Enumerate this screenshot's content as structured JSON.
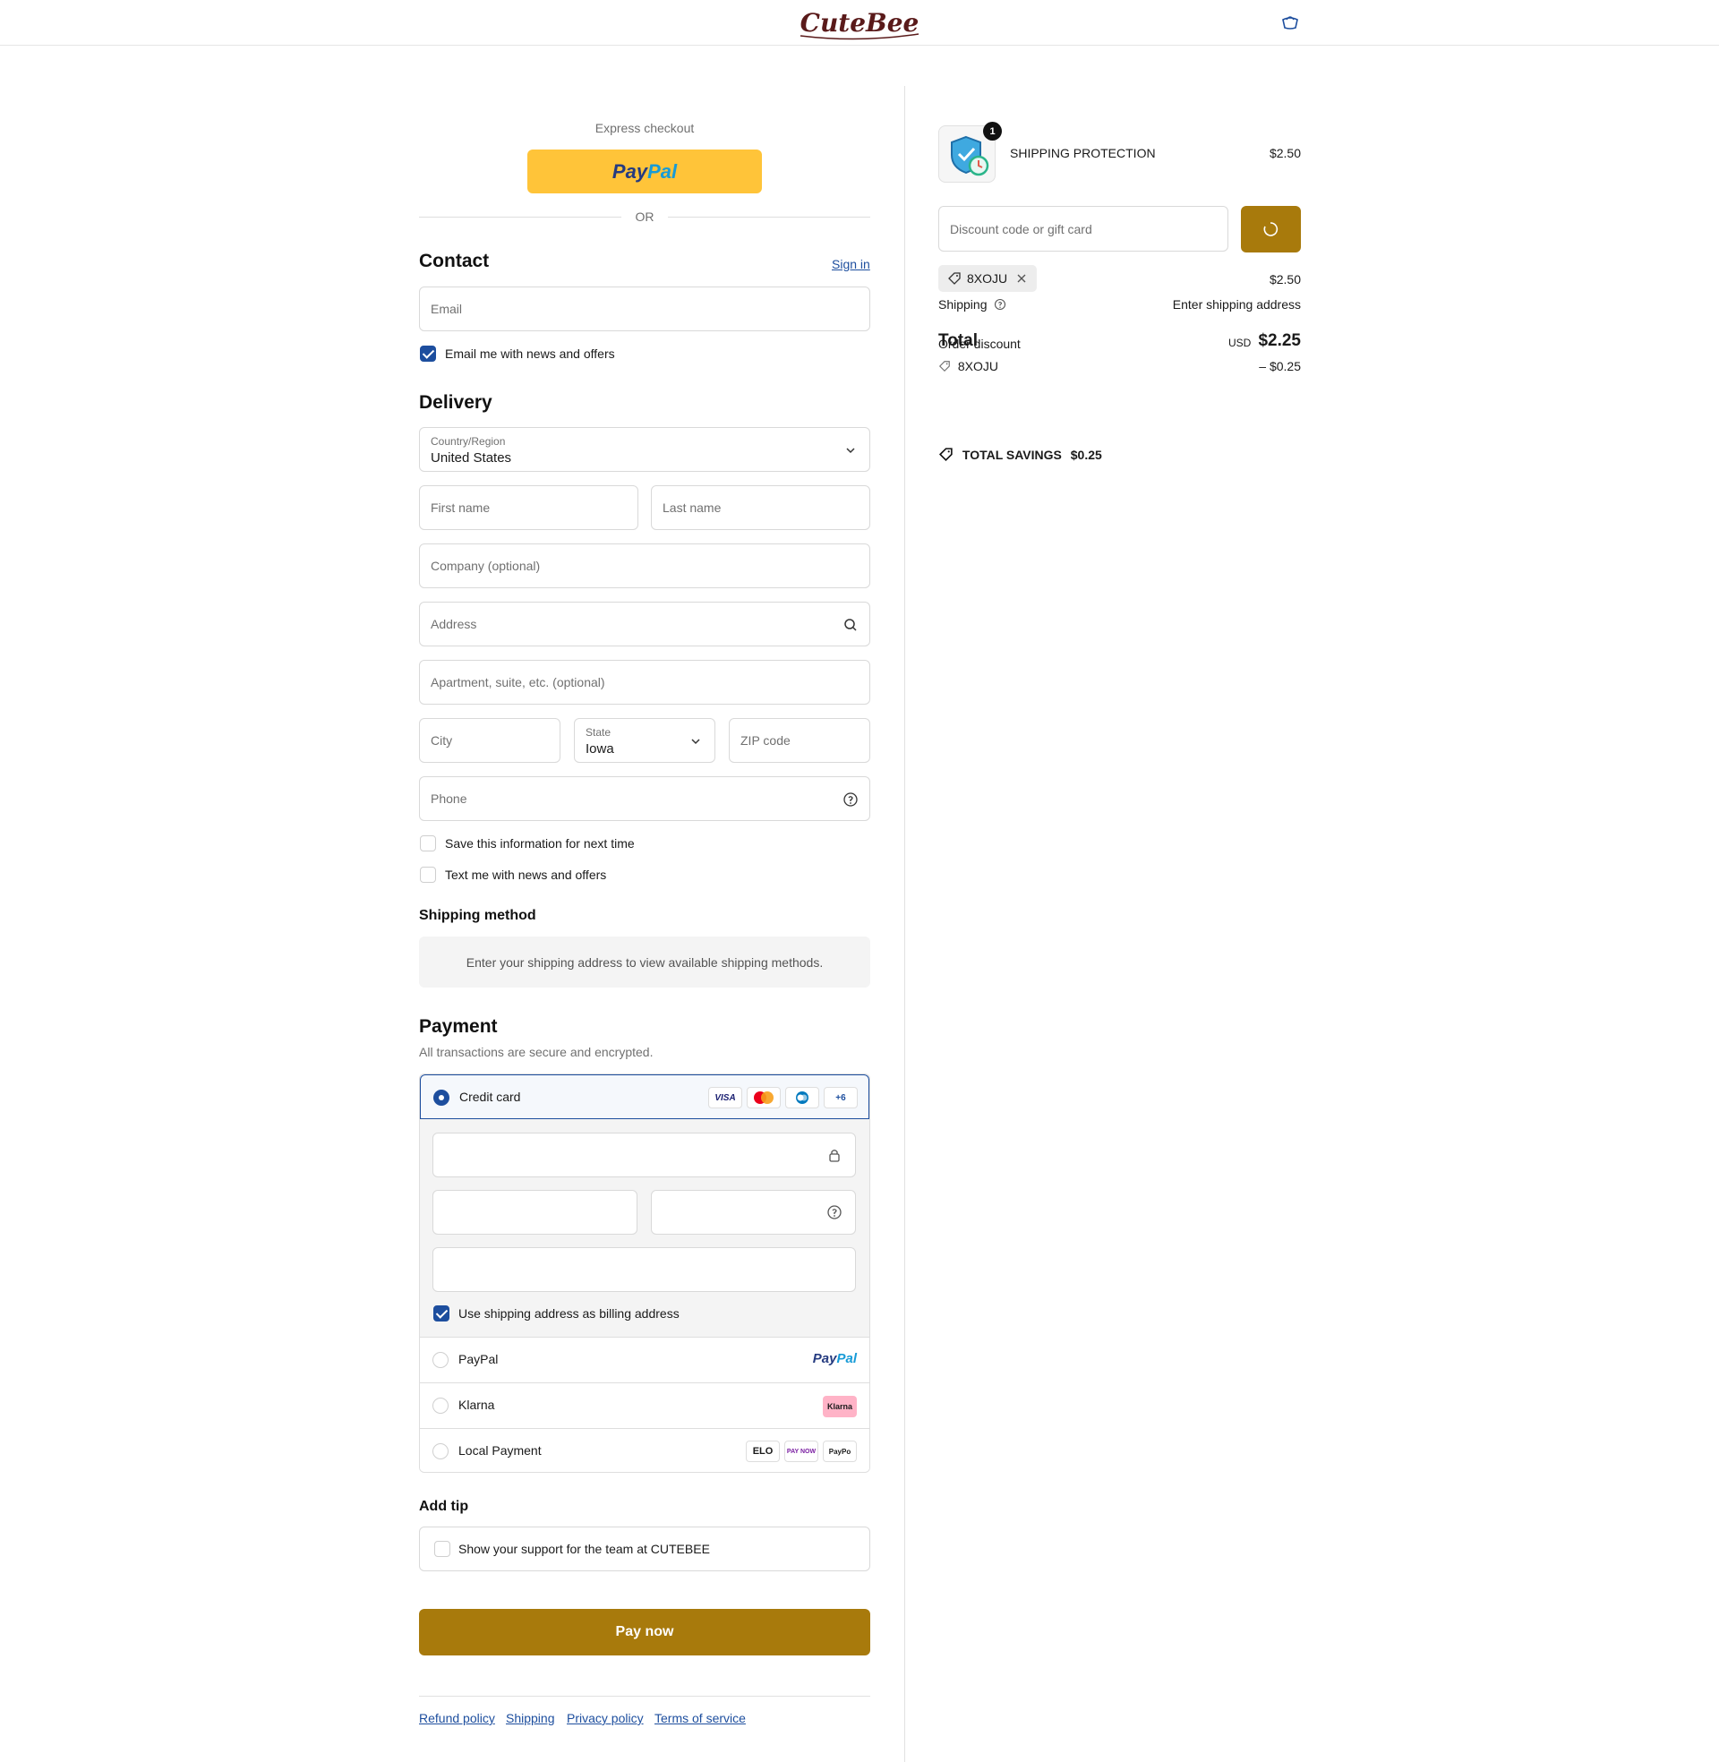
{
  "header": {
    "logo_text": "CuteBee",
    "cart_icon": "cart-icon"
  },
  "express": {
    "title": "Express checkout",
    "paypal_left": "Pay",
    "paypal_right": "Pal",
    "or_text": "OR"
  },
  "contact": {
    "title": "Contact",
    "sign_in": "Sign in",
    "email_placeholder": "Email",
    "news_checkbox_label": "Email me with news and offers",
    "news_checked": true
  },
  "delivery": {
    "title": "Delivery",
    "country_label": "Country/Region",
    "country_value": "United States",
    "first_name": "First name",
    "last_name": "Last name",
    "company": "Company (optional)",
    "address": "Address",
    "apartment": "Apartment, suite, etc. (optional)",
    "city": "City",
    "state_label": "State",
    "state_value": "Iowa",
    "zip": "ZIP code",
    "phone": "Phone",
    "save_info": "Save this information for next time",
    "text_offers": "Text me with news and offers"
  },
  "shipping_method": {
    "title": "Shipping method",
    "message": "Enter your shipping address to view available shipping methods."
  },
  "payment": {
    "title": "Payment",
    "subtitle": "All transactions are secure and encrypted.",
    "credit_card": "Credit card",
    "card_badges": [
      "VISA",
      "",
      "",
      "+6"
    ],
    "billing_checkbox": "Use shipping address as billing address",
    "paypal": "PayPal",
    "paypal_logo_left": "Pay",
    "paypal_logo_right": "Pal",
    "klarna": "Klarna",
    "klarna_logo": "Klarna",
    "local_payment": "Local Payment",
    "local_logos": [
      "ELO",
      "PAY NOW",
      "PayPo"
    ]
  },
  "tip": {
    "title": "Add tip",
    "label": "Show your support for the team at CUTEBEE"
  },
  "pay_now": "Pay now",
  "footer_links": [
    "Refund policy",
    "Shipping",
    "Privacy policy",
    "Terms of service"
  ],
  "summary": {
    "product_name": "SHIPPING PROTECTION",
    "product_price": "$2.50",
    "quantity": "1",
    "discount_placeholder": "Discount code or gift card",
    "code": "8XOJU",
    "subtotal_value": "$2.50",
    "shipping_label": "Shipping",
    "shipping_value": "Enter shipping address",
    "total_label": "Total",
    "order_discount_label": "Order discount",
    "currency": "USD",
    "total_value": "$2.25",
    "discount_code": "8XOJU",
    "discount_value": "– $0.25",
    "savings_label": "TOTAL SAVINGS",
    "savings_value": "$0.25"
  },
  "colors": {
    "accent": "#a87a0c",
    "link": "#1d4e9e",
    "paypal_yellow": "#ffc439"
  }
}
